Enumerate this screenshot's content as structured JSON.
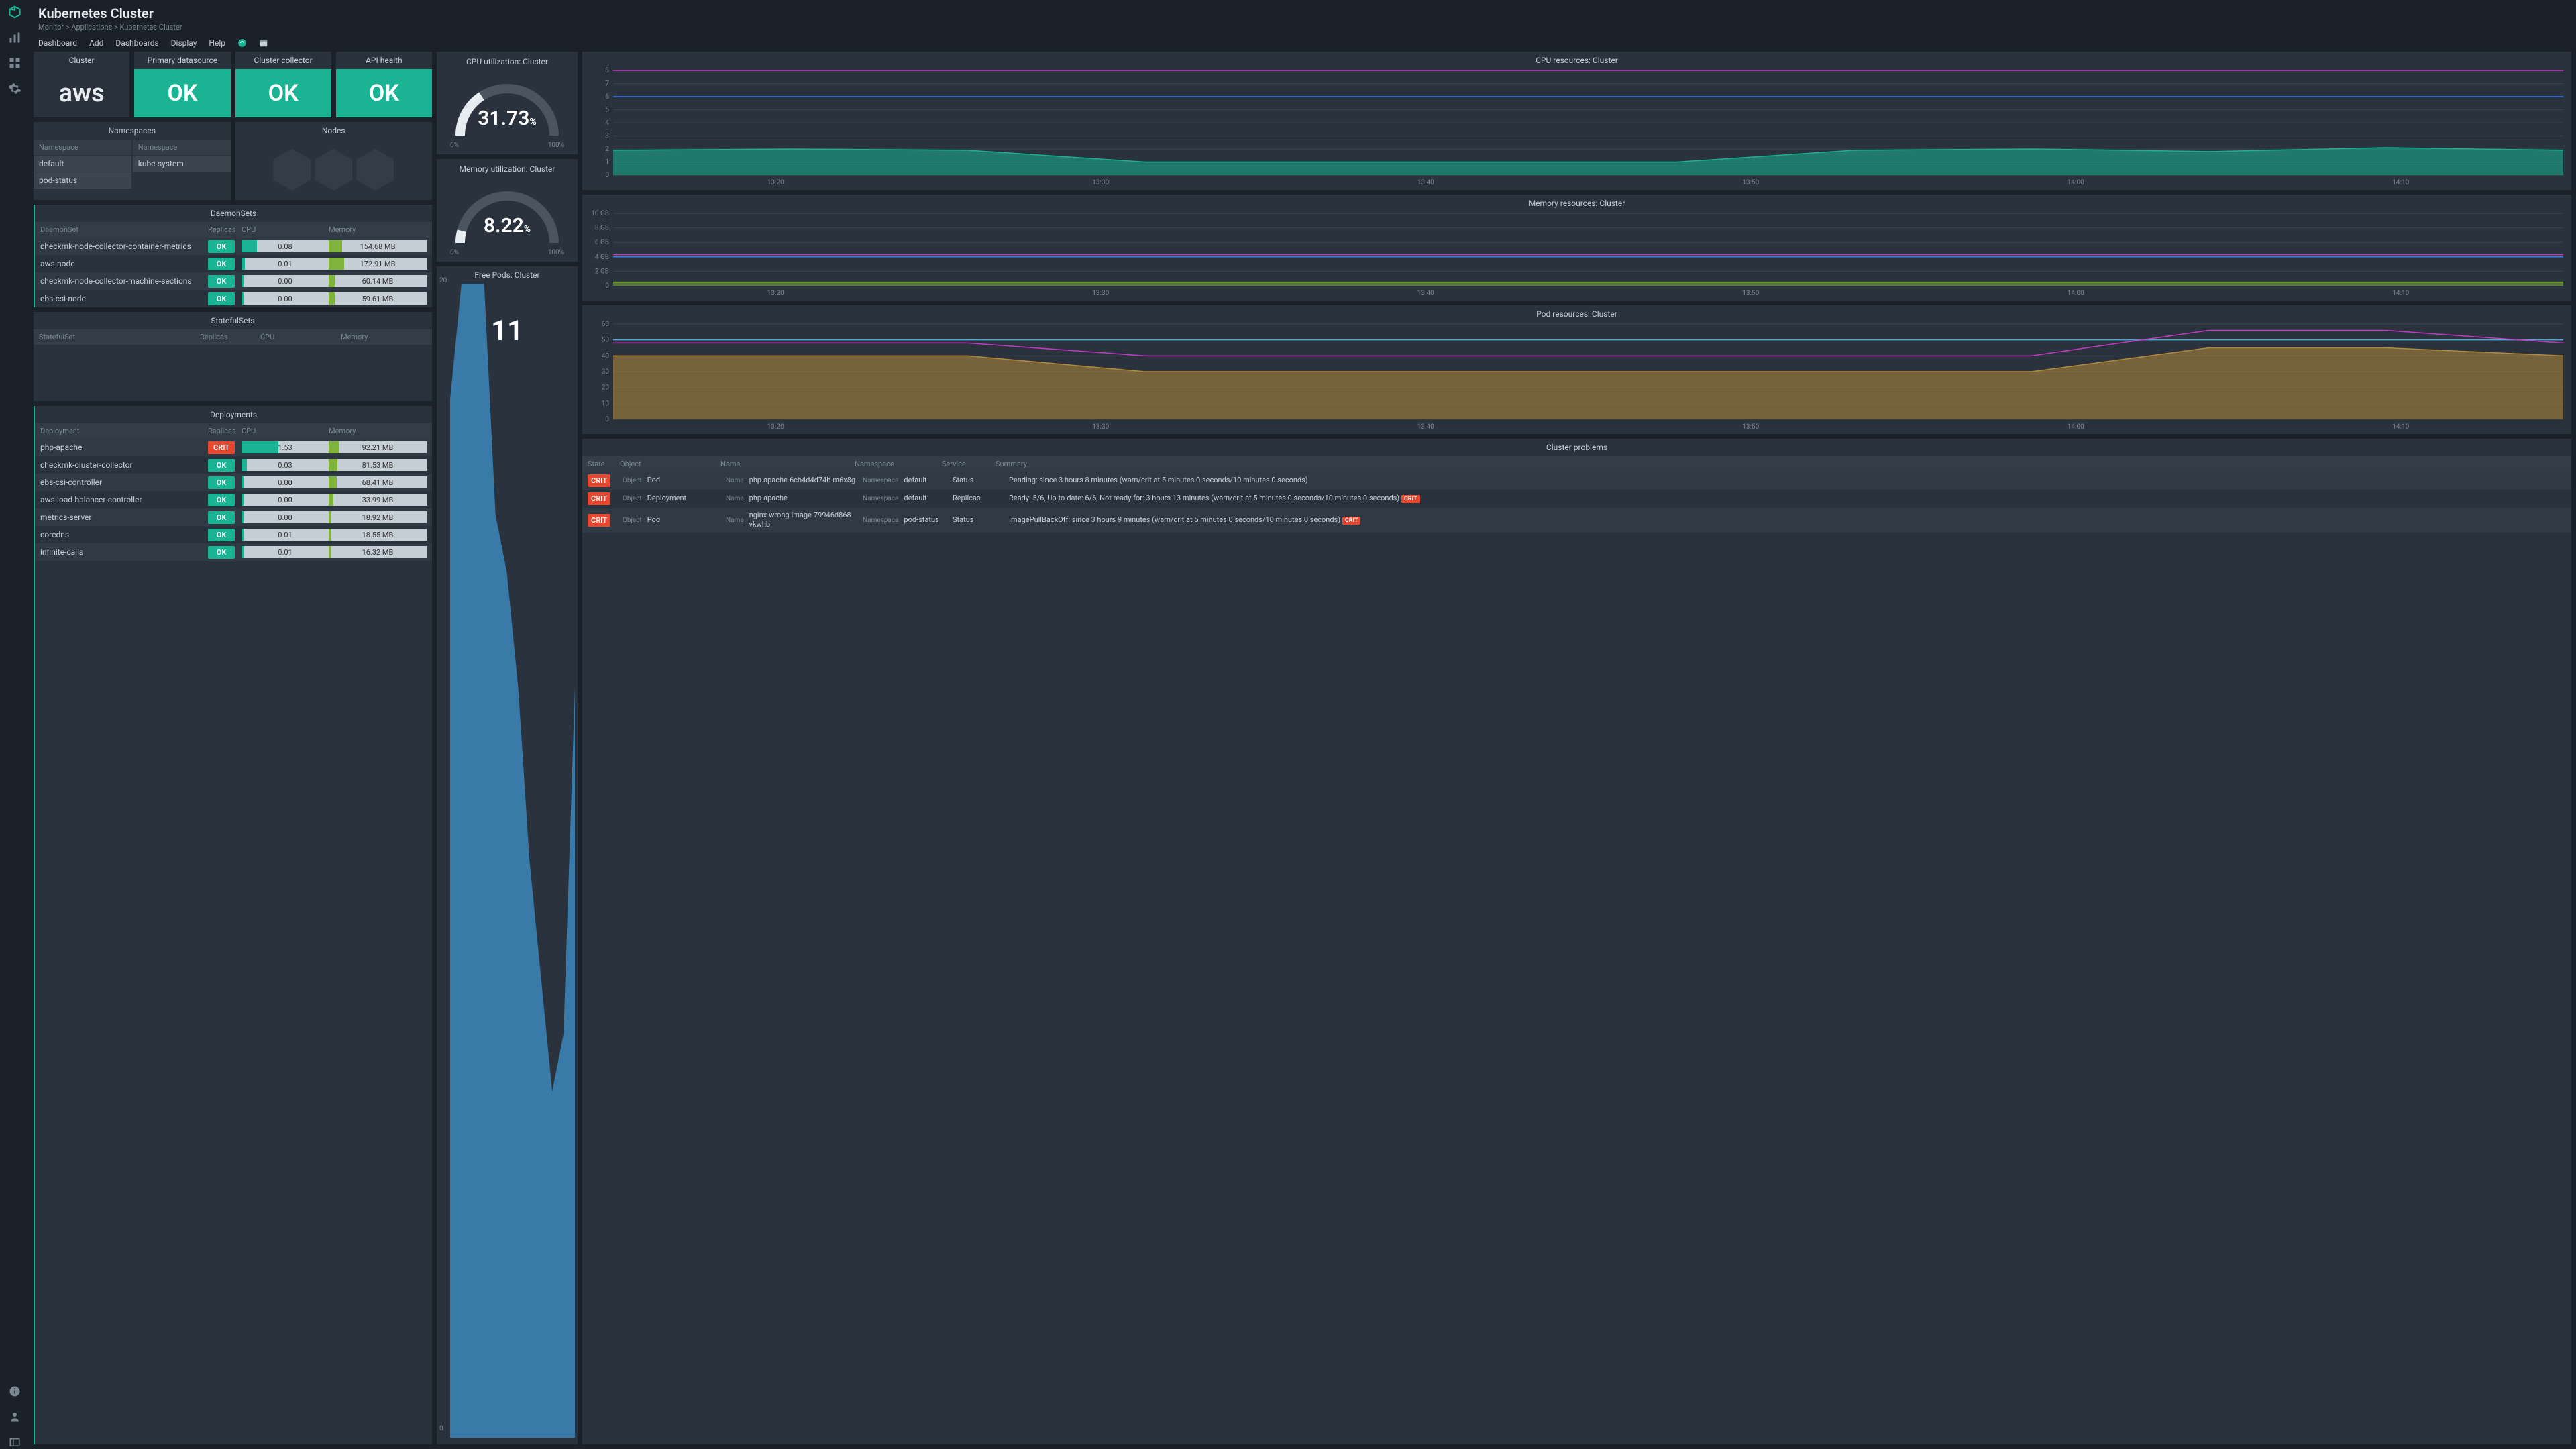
{
  "header": {
    "title": "Kubernetes Cluster",
    "breadcrumbs": "Monitor > Applications > Kubernetes Cluster"
  },
  "menubar": {
    "dashboard": "Dashboard",
    "add": "Add",
    "dashboards": "Dashboards",
    "display": "Display",
    "help": "Help"
  },
  "status_cards": {
    "cluster": {
      "label": "Cluster",
      "value": "aws"
    },
    "primary": {
      "label": "Primary datasource",
      "value": "OK"
    },
    "collector": {
      "label": "Cluster collector",
      "value": "OK"
    },
    "api": {
      "label": "API health",
      "value": "OK"
    }
  },
  "namespaces": {
    "title": "Namespaces",
    "col": "Namespace",
    "left": [
      "default",
      "pod-status"
    ],
    "right": [
      "kube-system"
    ]
  },
  "nodes": {
    "title": "Nodes"
  },
  "daemonsets": {
    "title": "DaemonSets",
    "cols": {
      "c0": "DaemonSet",
      "c1": "Replicas",
      "c2": "CPU",
      "c3": "Memory"
    },
    "rows": [
      {
        "name": "checkmk-node-collector-container-metrics",
        "status": "OK",
        "cpu": "0.08",
        "cpu_pct": 18,
        "mem": "154.68 MB",
        "mem_pct": 14
      },
      {
        "name": "aws-node",
        "status": "OK",
        "cpu": "0.01",
        "cpu_pct": 4,
        "mem": "172.91 MB",
        "mem_pct": 16
      },
      {
        "name": "checkmk-node-collector-machine-sections",
        "status": "OK",
        "cpu": "0.00",
        "cpu_pct": 2,
        "mem": "60.14 MB",
        "mem_pct": 6
      },
      {
        "name": "ebs-csi-node",
        "status": "OK",
        "cpu": "0.00",
        "cpu_pct": 2,
        "mem": "59.61 MB",
        "mem_pct": 6
      }
    ]
  },
  "statefulsets": {
    "title": "StatefulSets",
    "cols": {
      "c0": "StatefulSet",
      "c1": "Replicas",
      "c2": "CPU",
      "c3": "Memory"
    }
  },
  "deployments": {
    "title": "Deployments",
    "cols": {
      "c0": "Deployment",
      "c1": "Replicas",
      "c2": "CPU",
      "c3": "Memory"
    },
    "rows": [
      {
        "name": "php-apache",
        "status": "CRIT",
        "cpu": "1.53",
        "cpu_pct": 42,
        "mem": "92.21 MB",
        "mem_pct": 10
      },
      {
        "name": "checkmk-cluster-collector",
        "status": "OK",
        "cpu": "0.03",
        "cpu_pct": 6,
        "mem": "81.53 MB",
        "mem_pct": 9
      },
      {
        "name": "ebs-csi-controller",
        "status": "OK",
        "cpu": "0.00",
        "cpu_pct": 2,
        "mem": "68.41 MB",
        "mem_pct": 8
      },
      {
        "name": "aws-load-balancer-controller",
        "status": "OK",
        "cpu": "0.00",
        "cpu_pct": 2,
        "mem": "33.99 MB",
        "mem_pct": 5
      },
      {
        "name": "metrics-server",
        "status": "OK",
        "cpu": "0.00",
        "cpu_pct": 2,
        "mem": "18.92 MB",
        "mem_pct": 3
      },
      {
        "name": "coredns",
        "status": "OK",
        "cpu": "0.01",
        "cpu_pct": 3,
        "mem": "18.55 MB",
        "mem_pct": 3
      },
      {
        "name": "infinite-calls",
        "status": "OK",
        "cpu": "0.01",
        "cpu_pct": 3,
        "mem": "16.32 MB",
        "mem_pct": 3
      }
    ]
  },
  "gauges": {
    "cpu": {
      "title": "CPU utilization: Cluster",
      "value": "31.73",
      "unit": "%",
      "min": "0%",
      "max": "100%",
      "pct": 31.73
    },
    "mem": {
      "title": "Memory utilization: Cluster",
      "value": "8.22",
      "unit": "%",
      "min": "0%",
      "max": "100%",
      "pct": 8.22
    }
  },
  "freepods": {
    "title": "Free Pods: Cluster",
    "value": "11",
    "ymax": "20",
    "ymin": "0"
  },
  "charts": {
    "cpu": {
      "title": "CPU resources: Cluster"
    },
    "mem": {
      "title": "Memory resources: Cluster"
    },
    "pods": {
      "title": "Pod resources: Cluster"
    }
  },
  "xticks": [
    "13:20",
    "13:30",
    "13:40",
    "13:50",
    "14:00",
    "14:10"
  ],
  "problems": {
    "title": "Cluster problems",
    "cols": {
      "state": "State",
      "object": "Object",
      "name": "Name",
      "ns": "Namespace",
      "svc": "Service",
      "summary": "Summary"
    },
    "lab": {
      "object": "Object",
      "name": "Name",
      "ns": "Namespace"
    },
    "rows": [
      {
        "state": "CRIT",
        "object": "Pod",
        "name": "php-apache-6cb4d4d74b-m6x8g",
        "ns": "default",
        "svc": "Status",
        "summary": "Pending: since 3 hours 8 minutes (warn/crit at 5 minutes 0 seconds/10 minutes 0 seconds)",
        "pill": ""
      },
      {
        "state": "CRIT",
        "object": "Deployment",
        "name": "php-apache",
        "ns": "default",
        "svc": "Replicas",
        "summary": "Ready: 5/6, Up-to-date: 6/6, Not ready for: 3 hours 13 minutes (warn/crit at 5 minutes 0 seconds/10 minutes 0 seconds)",
        "pill": "CRIT"
      },
      {
        "state": "CRIT",
        "object": "Pod",
        "name": "nginx-wrong-image-79946d868-vkwhb",
        "ns": "pod-status",
        "svc": "Status",
        "summary": "ImagePullBackOff: since 3 hours 9 minutes (warn/crit at 5 minutes 0 seconds/10 minutes 0 seconds)",
        "pill": "CRIT"
      }
    ]
  },
  "chart_data": [
    {
      "type": "line",
      "title": "CPU resources: Cluster",
      "xticks": [
        "13:20",
        "13:30",
        "13:40",
        "13:50",
        "14:00",
        "14:10"
      ],
      "ylim": [
        0,
        8
      ],
      "yticks": [
        0,
        1,
        2,
        3,
        4,
        5,
        6,
        7,
        8
      ],
      "series": [
        {
          "name": "limit",
          "color": "#c639c6",
          "values": [
            8,
            8,
            8,
            8,
            8,
            8,
            8,
            8,
            8,
            8,
            8,
            8
          ]
        },
        {
          "name": "request",
          "color": "#3a7ae8",
          "values": [
            6,
            6,
            6,
            6,
            6,
            6,
            6,
            6,
            6,
            6,
            6,
            6
          ]
        },
        {
          "name": "usage",
          "color": "#1ab394",
          "area": true,
          "values": [
            1.9,
            2.0,
            1.9,
            1.0,
            1.0,
            1.0,
            1.0,
            1.9,
            2.0,
            1.8,
            2.1,
            1.9
          ]
        }
      ]
    },
    {
      "type": "line",
      "title": "Memory resources: Cluster",
      "xticks": [
        "13:20",
        "13:30",
        "13:40",
        "13:50",
        "14:00",
        "14:10"
      ],
      "ylim": [
        0,
        10
      ],
      "yticks": [
        0,
        2,
        4,
        6,
        8,
        10
      ],
      "yunit": "GB",
      "series": [
        {
          "name": "limit",
          "color": "#c639c6",
          "values": [
            4.3,
            4.3,
            4.3,
            4.3,
            4.3,
            4.3,
            4.3,
            4.3,
            4.3,
            4.3,
            4.3,
            4.3
          ]
        },
        {
          "name": "request",
          "color": "#3a7ae8",
          "values": [
            4.0,
            4.0,
            4.0,
            4.0,
            4.0,
            4.0,
            4.0,
            4.0,
            4.0,
            4.0,
            4.0,
            4.0
          ]
        },
        {
          "name": "usage",
          "color": "#7fb33c",
          "area": true,
          "values": [
            0.5,
            0.5,
            0.5,
            0.5,
            0.5,
            0.5,
            0.5,
            0.5,
            0.5,
            0.5,
            0.5,
            0.5
          ]
        }
      ]
    },
    {
      "type": "line",
      "title": "Pod resources: Cluster",
      "xticks": [
        "13:20",
        "13:30",
        "13:40",
        "13:50",
        "14:00",
        "14:10"
      ],
      "ylim": [
        0,
        60
      ],
      "yticks": [
        0,
        10,
        20,
        30,
        40,
        50,
        60
      ],
      "series": [
        {
          "name": "capacity",
          "color": "#4aa8d8",
          "values": [
            50,
            50,
            50,
            50,
            50,
            50,
            50,
            50,
            50,
            50,
            50,
            50
          ]
        },
        {
          "name": "allocatable",
          "color": "#c639c6",
          "values": [
            48,
            48,
            48,
            40,
            40,
            40,
            40,
            40,
            40,
            56,
            56,
            48
          ]
        },
        {
          "name": "running",
          "color": "#b58a3c",
          "area": true,
          "values": [
            40,
            40,
            40,
            30,
            30,
            30,
            30,
            30,
            30,
            45,
            45,
            40
          ]
        }
      ]
    },
    {
      "type": "area",
      "title": "Free Pods: Cluster",
      "ylim": [
        0,
        20
      ],
      "x": [
        0,
        1,
        2,
        3,
        4,
        5,
        6,
        7,
        8,
        9,
        10,
        11
      ],
      "values": [
        18,
        20,
        20,
        20,
        16,
        15,
        13,
        10,
        8,
        6,
        7,
        13
      ],
      "current": 11
    }
  ]
}
